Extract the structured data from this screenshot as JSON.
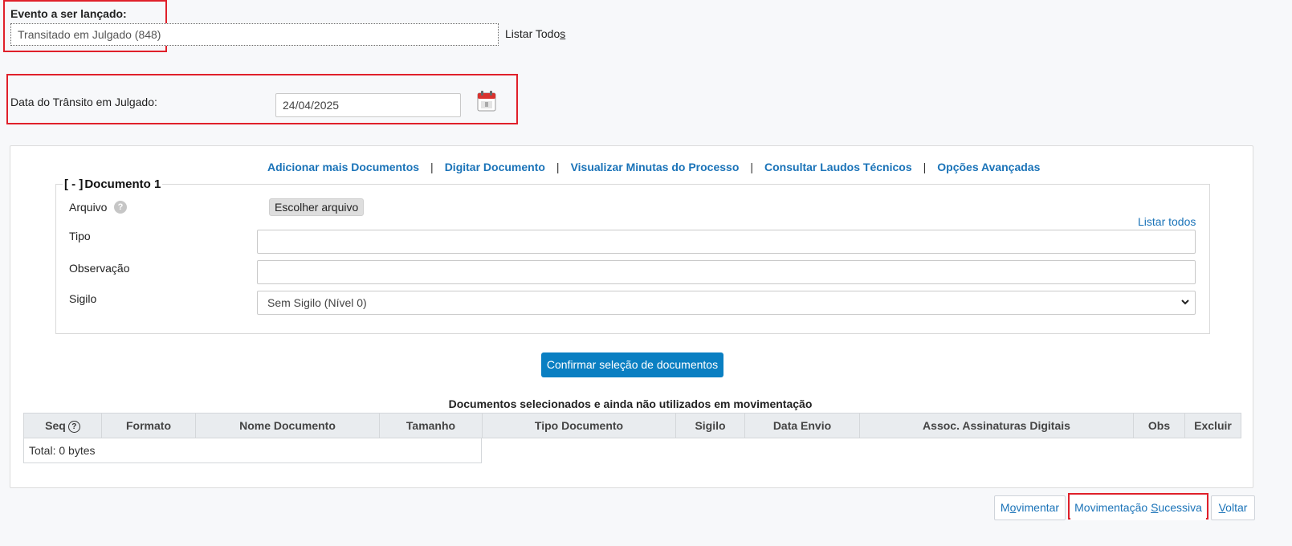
{
  "evento": {
    "label": "Evento a ser lançado:",
    "value": "Transitado em Julgado (848)",
    "listar_todos_pre": "Listar Todo",
    "listar_todos_ul": "s"
  },
  "transito": {
    "label": "Data do Trânsito em Julgado:",
    "date": "24/04/2025"
  },
  "toplinks": {
    "add_docs": "Adicionar mais Documentos",
    "digitar": "Digitar Documento",
    "minutas": "Visualizar Minutas do Processo",
    "laudos": "Consultar Laudos Técnicos",
    "opcoes": "Opções Avançadas",
    "separator": "|"
  },
  "documento": {
    "toggle": "[ - ]",
    "title": "Documento 1",
    "arquivo_label": "Arquivo",
    "help_glyph": "?",
    "file_button": "Escolher arquivo",
    "listar_todos": "Listar todos",
    "tipo_label": "Tipo",
    "observacao_label": "Observação",
    "sigilo_label": "Sigilo",
    "sigilo_value": "Sem Sigilo (Nível 0)"
  },
  "confirm_button": "Confirmar seleção de documentos",
  "table": {
    "caption": "Documentos selecionados e ainda não utilizados em movimentação",
    "seq_help": "?",
    "columns": [
      "Seq",
      "Formato",
      "Nome Documento",
      "Tamanho",
      "Tipo Documento",
      "Sigilo",
      "Data Envio",
      "Assoc. Assinaturas Digitais",
      "Obs",
      "Excluir"
    ],
    "total": "Total: 0 bytes"
  },
  "actions": {
    "movimentar_a": "M",
    "movimentar_ul": "o",
    "movimentar_b": "vimentar",
    "sucessiva_a": "Movimentação ",
    "sucessiva_ul": "S",
    "sucessiva_b": "ucessiva",
    "voltar_ul": "V",
    "voltar_b": "oltar"
  },
  "colors": {
    "link": "#1a73b8",
    "primary_button": "#0a7fc2",
    "highlight": "#e0202a"
  },
  "icons": {
    "calendar": "calendar-icon",
    "help": "help-icon",
    "select_arrow": "chevron-down-icon"
  }
}
